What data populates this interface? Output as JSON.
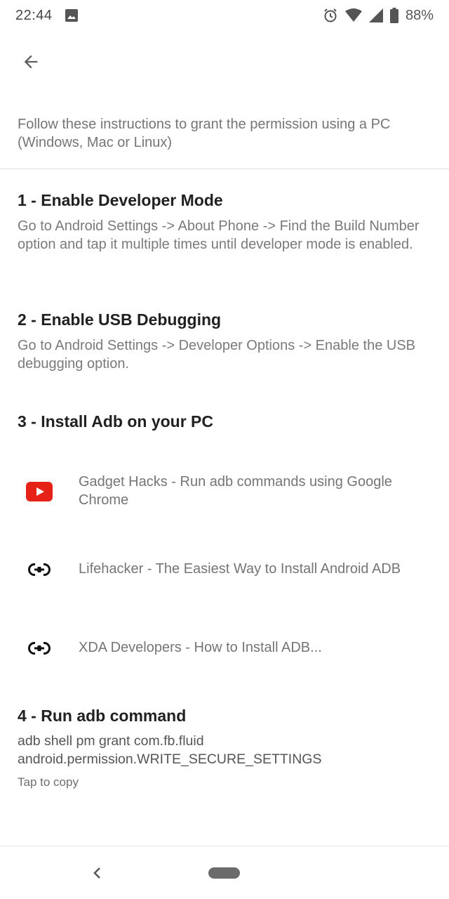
{
  "status_bar": {
    "time": "22:44",
    "battery": "88%",
    "icons": [
      "image-icon",
      "alarm-icon",
      "wifi-icon",
      "signal-icon",
      "battery-icon"
    ]
  },
  "intro": "Follow these instructions to grant the permission using a PC (Windows, Mac or Linux)",
  "steps": [
    {
      "title": "1 - Enable Developer Mode",
      "description": "Go to Android Settings -> About Phone -> Find the Build Number option and tap it multiple times until developer mode is enabled."
    },
    {
      "title": "2 - Enable USB Debugging",
      "description": "Go to Android Settings -> Developer Options -> Enable the USB debugging option."
    },
    {
      "title": "3 - Install Adb on your PC",
      "links": [
        {
          "icon": "youtube-icon",
          "label": "Gadget Hacks - Run adb commands using Google Chrome"
        },
        {
          "icon": "link-icon",
          "label": "Lifehacker - The Easiest Way to Install Android ADB"
        },
        {
          "icon": "link-icon",
          "label": "XDA Developers - How to Install ADB..."
        }
      ]
    },
    {
      "title": "4 - Run adb command",
      "command_line1": "adb shell pm grant com.fb.fluid",
      "command_line2": "android.permission.WRITE_SECURE_SETTINGS",
      "hint": "Tap to copy"
    }
  ],
  "colors": {
    "youtube_red": "#e62117",
    "text_primary": "#212121",
    "text_secondary": "#757575"
  }
}
